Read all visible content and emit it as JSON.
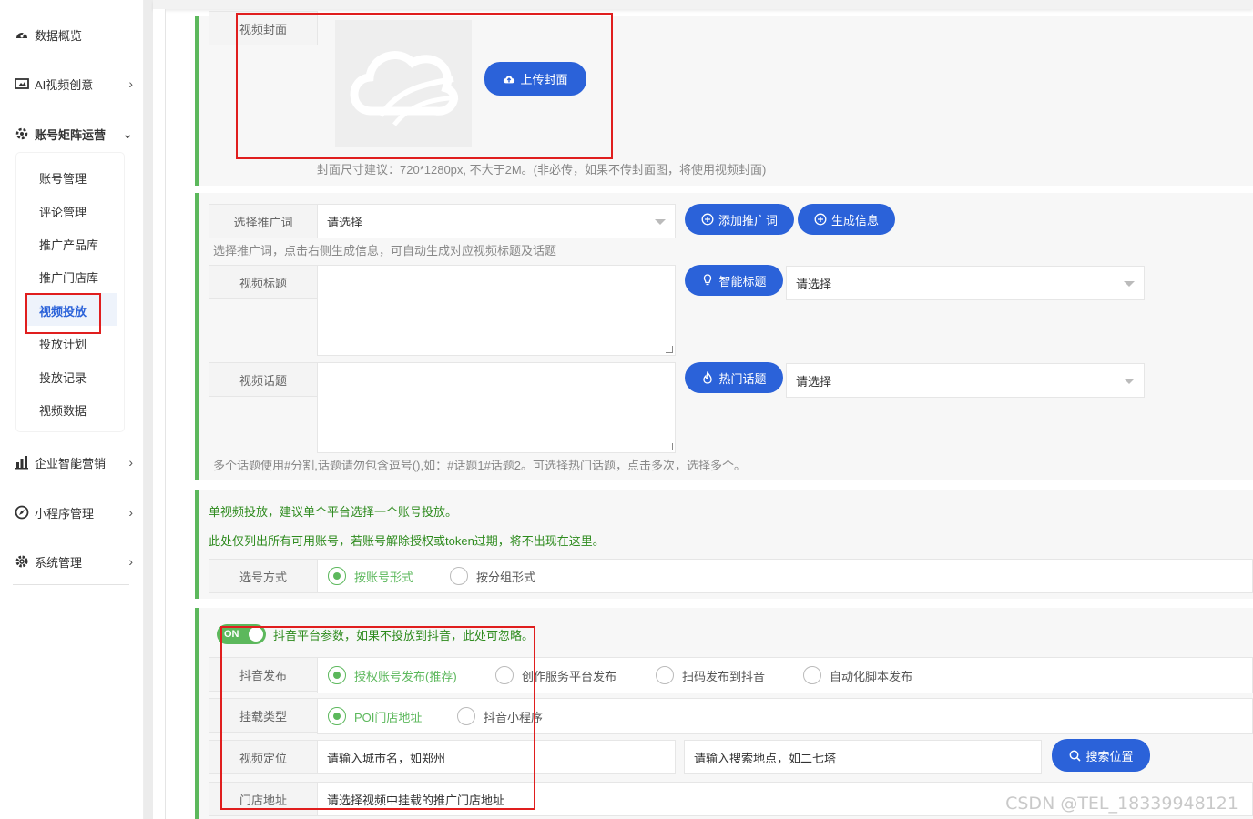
{
  "sidebar": {
    "items": [
      {
        "label": "数据概览",
        "icon": "dashboard-icon"
      },
      {
        "label": "AI视频创意",
        "icon": "ai-video-icon"
      },
      {
        "label": "账号矩阵运营",
        "icon": "matrix-icon"
      },
      {
        "label": "企业智能营销",
        "icon": "bar-chart-icon"
      },
      {
        "label": "小程序管理",
        "icon": "miniapp-icon"
      },
      {
        "label": "系统管理",
        "icon": "gear-icon"
      }
    ],
    "submenu": [
      "账号管理",
      "评论管理",
      "推广产品库",
      "推广门店库",
      "视频投放",
      "投放计划",
      "投放记录",
      "视频数据"
    ],
    "active_submenu": "视频投放"
  },
  "cover": {
    "label": "视频封面",
    "upload_button": "上传封面",
    "hint": "封面尺寸建议：720*1280px, 不大于2M。(非必传，如果不传封面图，将使用视频封面)"
  },
  "promo": {
    "keyword_label": "选择推广词",
    "keyword_placeholder": "请选择",
    "add_keyword_button": "添加推广词",
    "generate_button": "生成信息",
    "keyword_hint": "选择推广词，点击右侧生成信息，可自动生成对应视频标题及话题",
    "title_label": "视频标题",
    "smart_title_button": "智能标题",
    "title_select_placeholder": "请选择",
    "topic_label": "视频话题",
    "hot_topic_button": "热门话题",
    "topic_select_placeholder": "请选择",
    "topic_hint": "多个话题使用#分割,话题请勿包含逗号(),如：#话题1#话题2。可选择热门话题，点击多次，选择多个。"
  },
  "account": {
    "notice1": "单视频投放，建议单个平台选择一个账号投放。",
    "notice2": "此处仅列出所有可用账号，若账号解除授权或token过期，将不出现在这里。",
    "select_mode_label": "选号方式",
    "mode_options": [
      "按账号形式",
      "按分组形式"
    ],
    "mode_selected": "按账号形式"
  },
  "douyin": {
    "toggle_text": "ON",
    "toggle_on": true,
    "toggle_desc": "抖音平台参数，如果不投放到抖音，此处可忽略。",
    "publish_label": "抖音发布",
    "publish_options": [
      "授权账号发布(推荐)",
      "创作服务平台发布",
      "扫码发布到抖音",
      "自动化脚本发布"
    ],
    "publish_selected": "授权账号发布(推荐)",
    "mount_label": "挂载类型",
    "mount_options": [
      "POI门店地址",
      "抖音小程序"
    ],
    "mount_selected": "POI门店地址",
    "location_label": "视频定位",
    "city_placeholder": "请输入城市名，如郑州",
    "place_placeholder": "请输入搜索地点，如二七塔",
    "search_button": "搜索位置",
    "store_label": "门店地址",
    "store_placeholder": "请选择视频中挂载的推广门店地址"
  },
  "colors": {
    "primary": "#2b62d9",
    "success": "#5cb85c",
    "annotation": "#e01e1e"
  },
  "watermark": "CSDN @TEL_18339948121"
}
